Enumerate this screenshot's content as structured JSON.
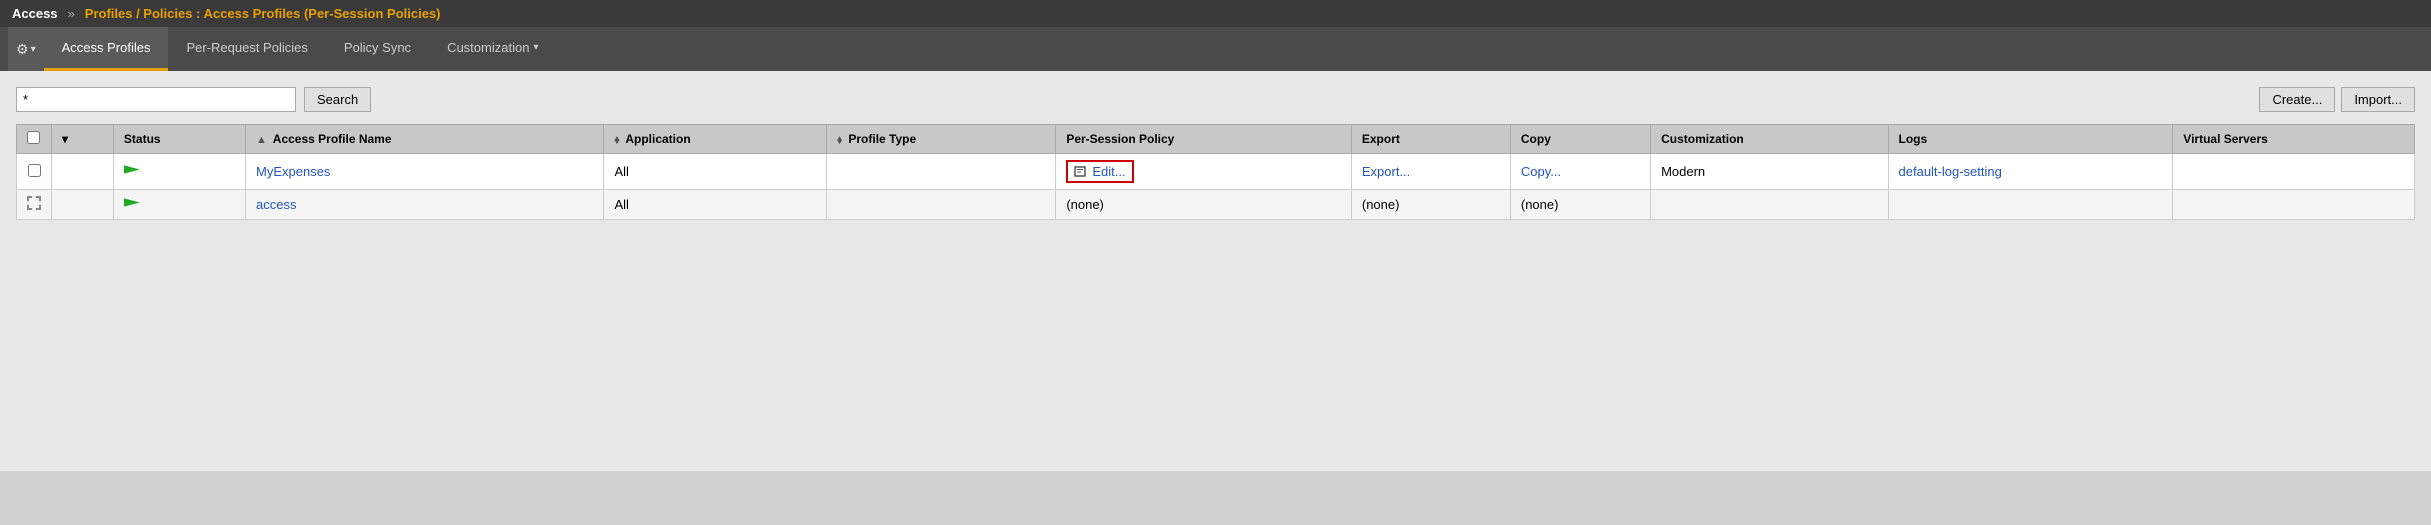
{
  "header": {
    "app_name": "Access",
    "chevrons": "»",
    "breadcrumb": "Profiles / Policies : Access Profiles (Per-Session Policies)"
  },
  "tabs": {
    "gear_label": "⚙",
    "gear_arrow": "▾",
    "items": [
      {
        "id": "access-profiles",
        "label": "Access Profiles",
        "active": true,
        "has_arrow": false
      },
      {
        "id": "per-request-policies",
        "label": "Per-Request Policies",
        "active": false,
        "has_arrow": false
      },
      {
        "id": "policy-sync",
        "label": "Policy Sync",
        "active": false,
        "has_arrow": false
      },
      {
        "id": "customization",
        "label": "Customization",
        "active": false,
        "has_arrow": true
      }
    ]
  },
  "search": {
    "input_value": "*",
    "input_placeholder": "",
    "button_label": "Search"
  },
  "top_buttons": {
    "create_label": "Create...",
    "import_label": "Import..."
  },
  "table": {
    "columns": [
      {
        "id": "checkbox",
        "label": ""
      },
      {
        "id": "dropdown",
        "label": ""
      },
      {
        "id": "status",
        "label": "Status",
        "sortable": false
      },
      {
        "id": "name",
        "label": "Access Profile Name",
        "sort": "▲"
      },
      {
        "id": "application",
        "label": "Application",
        "sort": "⬧"
      },
      {
        "id": "profile-type",
        "label": "Profile Type",
        "sort": "⬧"
      },
      {
        "id": "per-session-policy",
        "label": "Per-Session Policy"
      },
      {
        "id": "export",
        "label": "Export"
      },
      {
        "id": "copy",
        "label": "Copy"
      },
      {
        "id": "customization",
        "label": "Customization"
      },
      {
        "id": "logs",
        "label": "Logs"
      },
      {
        "id": "virtual-servers",
        "label": "Virtual Servers"
      }
    ],
    "rows": [
      {
        "id": "row1",
        "name": "MyExpenses",
        "application": "All",
        "profile_type": "",
        "per_session_policy": "Edit...",
        "per_session_highlighted": true,
        "export": "Export...",
        "copy": "Copy...",
        "customization": "Modern",
        "customization_is_link": false,
        "logs": "default-log-setting",
        "logs_is_link": true,
        "virtual_servers": ""
      },
      {
        "id": "row2",
        "name": "access",
        "application": "All",
        "profile_type": "",
        "per_session_policy": "(none)",
        "per_session_highlighted": false,
        "export": "(none)",
        "copy": "(none)",
        "customization": "",
        "customization_is_link": false,
        "logs": "",
        "logs_is_link": false,
        "virtual_servers": ""
      }
    ]
  }
}
